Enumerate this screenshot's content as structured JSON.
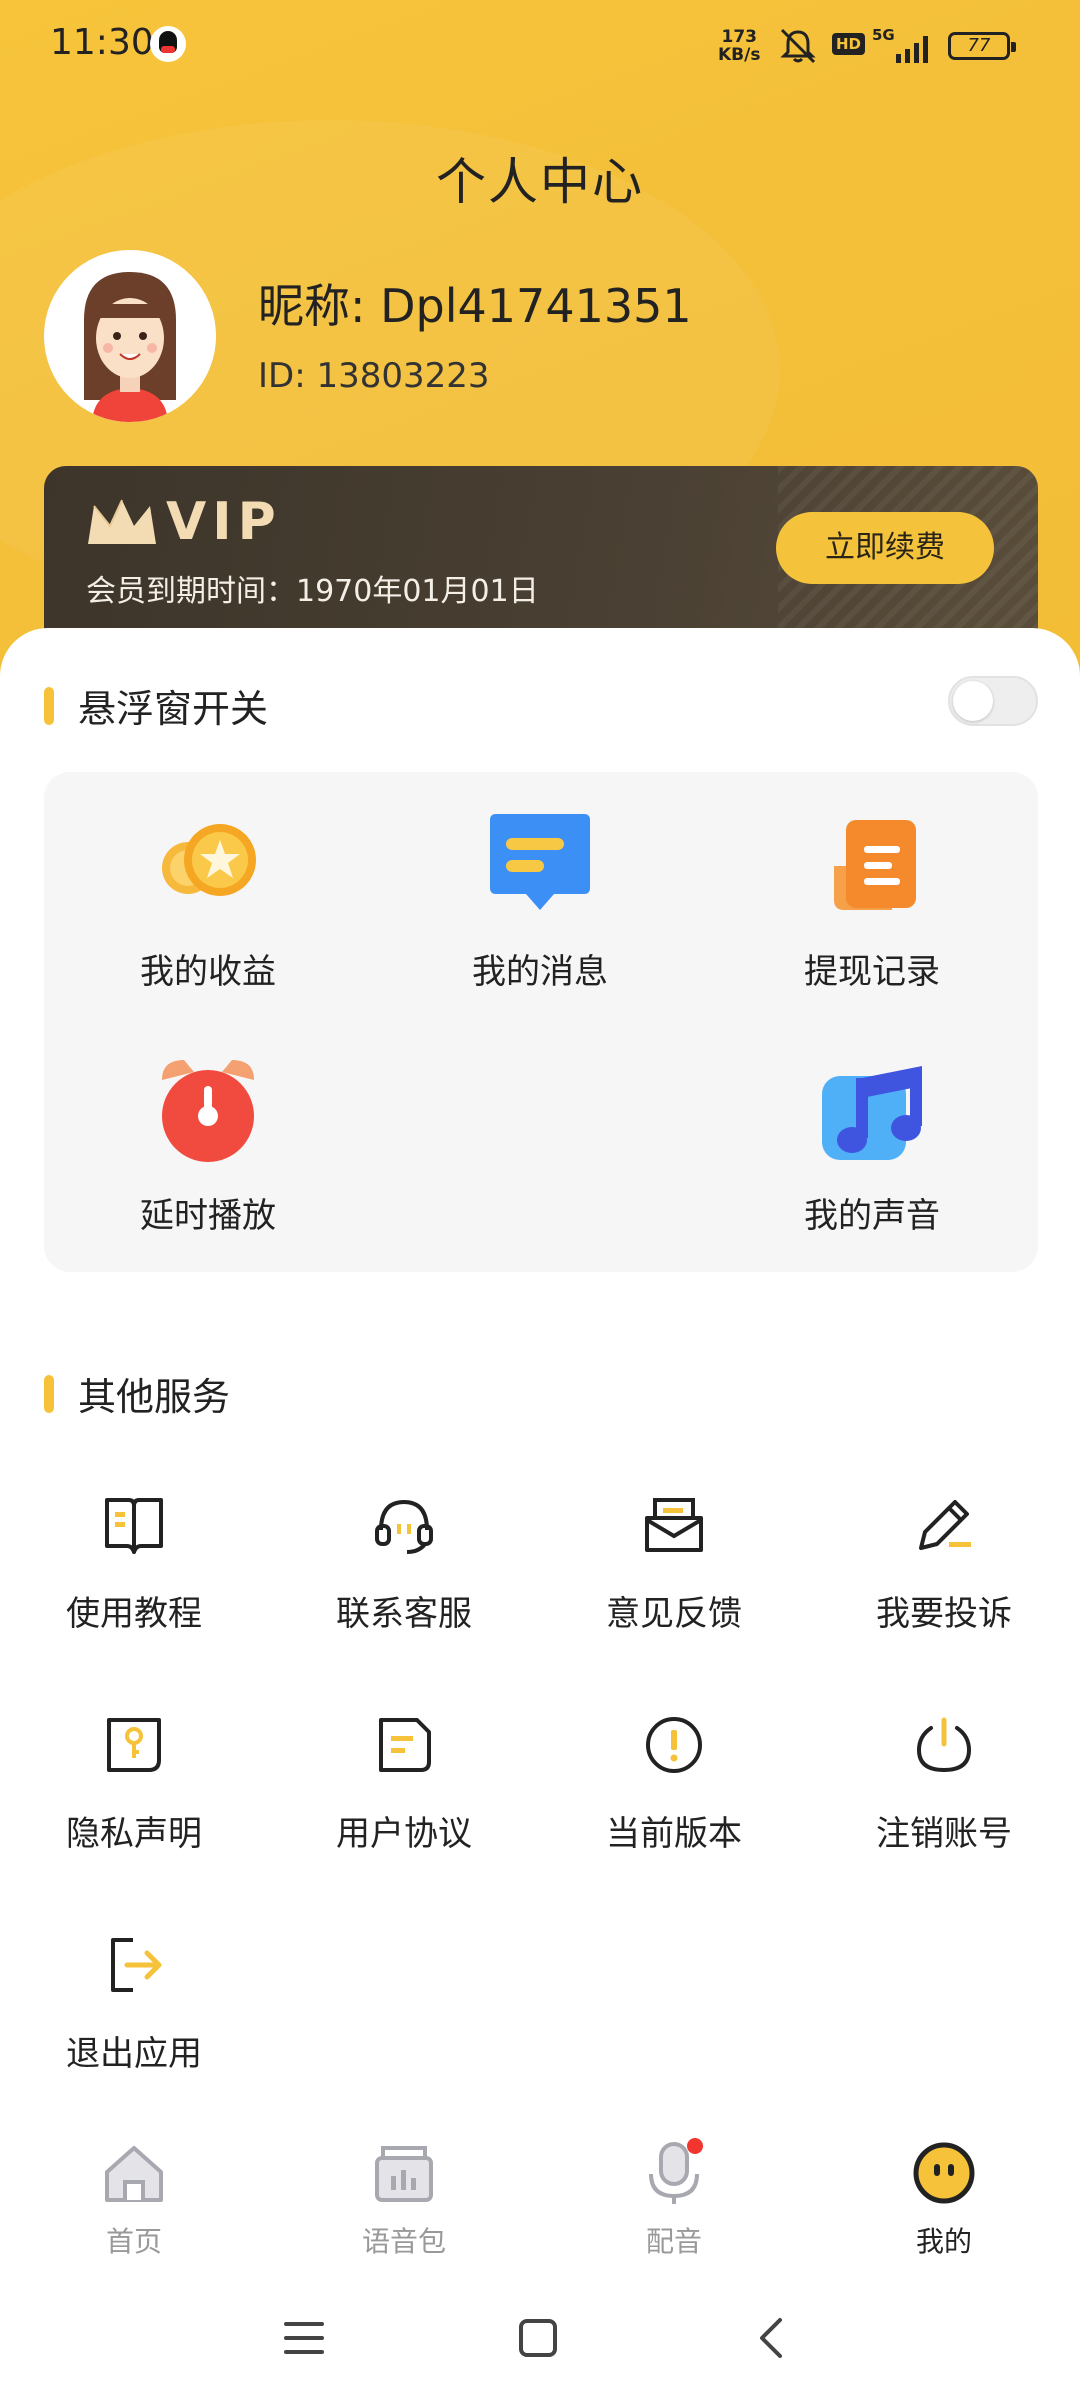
{
  "status_bar": {
    "time": "11:30",
    "net_speed_value": "173",
    "net_speed_unit": "KB/s",
    "hd": "HD",
    "network": "5G",
    "battery": "77"
  },
  "header": {
    "title": "个人中心"
  },
  "profile": {
    "nickname": "昵称: Dpl41741351",
    "id": "ID: 13803223"
  },
  "vip": {
    "logo_text": "VIP",
    "expiry": "会员到期时间：1970年01月01日",
    "renew_label": "立即续费"
  },
  "floating_window": {
    "title": "悬浮窗开关",
    "enabled": false
  },
  "features": [
    {
      "label": "我的收益",
      "icon": "coins-icon"
    },
    {
      "label": "我的消息",
      "icon": "message-icon"
    },
    {
      "label": "提现记录",
      "icon": "withdraw-record-icon"
    },
    {
      "label": "延时播放",
      "icon": "alarm-clock-icon"
    },
    {
      "label": "我的声音",
      "icon": "music-note-icon"
    }
  ],
  "other_services": {
    "title": "其他服务",
    "items": [
      {
        "label": "使用教程",
        "icon": "book-icon"
      },
      {
        "label": "联系客服",
        "icon": "headset-icon"
      },
      {
        "label": "意见反馈",
        "icon": "mail-icon"
      },
      {
        "label": "我要投诉",
        "icon": "pencil-icon"
      },
      {
        "label": "隐私声明",
        "icon": "key-icon"
      },
      {
        "label": "用户协议",
        "icon": "document-icon"
      },
      {
        "label": "当前版本",
        "icon": "info-icon"
      },
      {
        "label": "注销账号",
        "icon": "power-icon"
      },
      {
        "label": "退出应用",
        "icon": "exit-icon"
      }
    ]
  },
  "tabbar": [
    {
      "label": "首页",
      "icon": "home-icon",
      "active": false
    },
    {
      "label": "语音包",
      "icon": "voice-pack-icon",
      "active": false
    },
    {
      "label": "配音",
      "icon": "microphone-icon",
      "active": false,
      "badge": true
    },
    {
      "label": "我的",
      "icon": "profile-face-icon",
      "active": true
    }
  ],
  "colors": {
    "accent": "#f5c23a",
    "vip_card": "#3d352a",
    "text": "#222222",
    "inactive_tab": "#999999"
  }
}
